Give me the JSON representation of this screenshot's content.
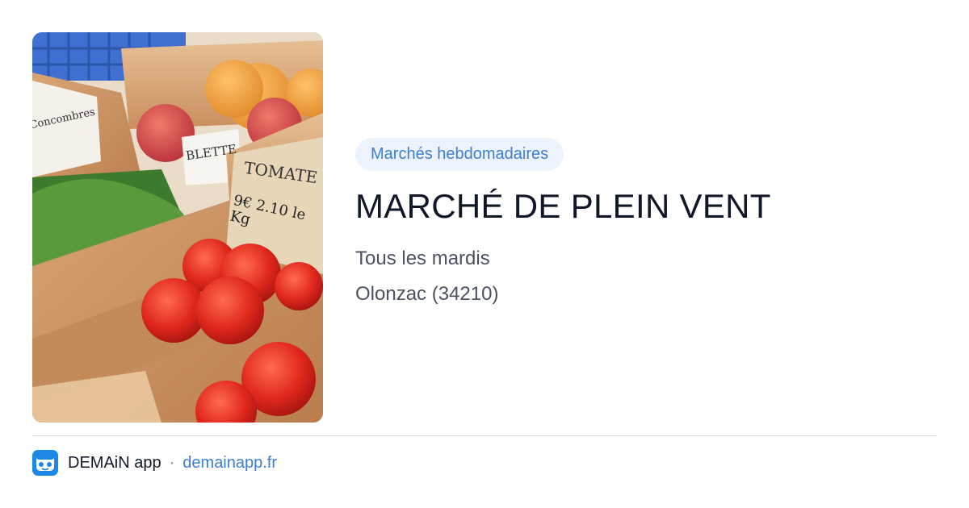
{
  "photo": {
    "description_icon": "market-produce-photo",
    "sign_labels": [
      "BLETTE",
      "TOMATE",
      "9€ 2.10 le Kg",
      "Concombres"
    ]
  },
  "info": {
    "badge": "Marchés hebdomadaires",
    "title": "MARCHÉ DE PLEIN VENT",
    "schedule": "Tous les mardis",
    "location": "Olonzac (34210)"
  },
  "footer": {
    "app_icon": "demain-app-icon",
    "app_name": "DEMAiN app",
    "separator": "·",
    "domain": "demainapp.fr"
  },
  "colors": {
    "accent": "#3d7fcf",
    "badge_bg": "#edf3fc",
    "title": "#101828",
    "text": "#4a5263",
    "divider": "#d9e0e6"
  }
}
